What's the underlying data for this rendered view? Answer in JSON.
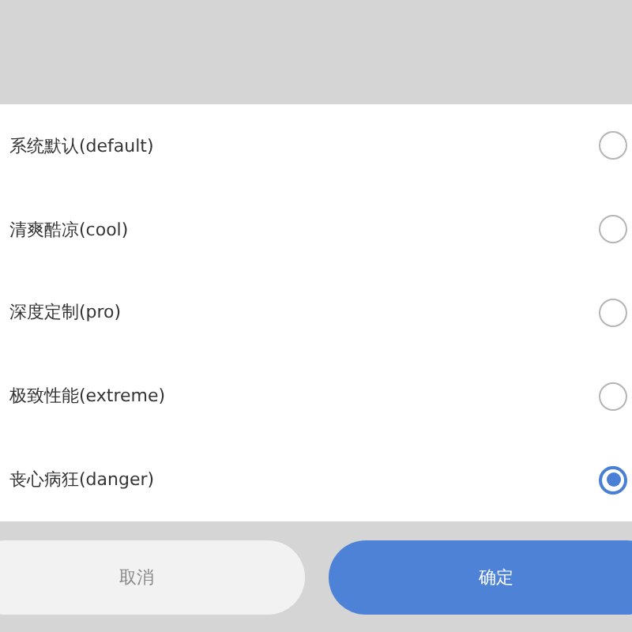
{
  "options": [
    {
      "label": "系统默认(default)",
      "selected": false
    },
    {
      "label": "清爽酷凉(cool)",
      "selected": false
    },
    {
      "label": "深度定制(pro)",
      "selected": false
    },
    {
      "label": "极致性能(extreme)",
      "selected": false
    },
    {
      "label": "丧心病狂(danger)",
      "selected": true
    }
  ],
  "buttons": [
    {
      "label": "取消",
      "kind": "cancel"
    },
    {
      "label": "确定",
      "kind": "confirm"
    }
  ]
}
